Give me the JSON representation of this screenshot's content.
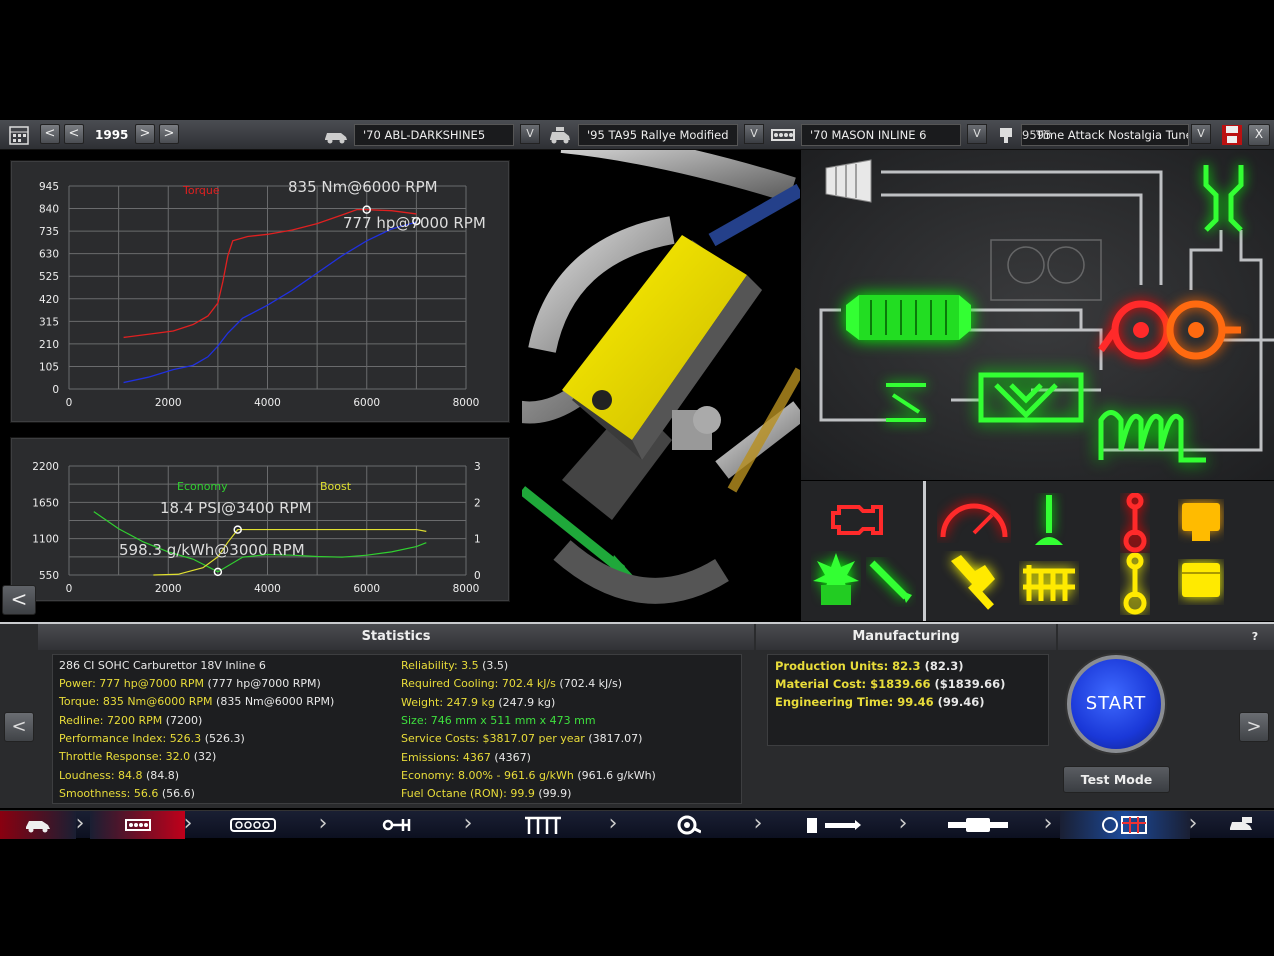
{
  "toolbar": {
    "year": "1995",
    "body_select": "'70   ABL-DARKSHINE5",
    "trim_select": "'95 TA95  Rallye Modified",
    "engine_select": "'70   MASON INLINE  6",
    "variant_select_prefix": "9595",
    "variant_select": "Time Attack  Nostalgia Tuned",
    "dropdown_glyph": "V",
    "prev_glyph": "<",
    "next_glyph": ">",
    "close_glyph": "X"
  },
  "power_chart": {
    "legend": "Torque",
    "annotation_torque": "835 Nm@6000 RPM",
    "annotation_power": "777 hp@7000 RPM"
  },
  "boost_chart": {
    "legend_economy": "Economy",
    "legend_boost": "Boost",
    "annotation_boost": "18.4 PSI@3400 RPM",
    "annotation_economy": "598.3 g/kWh@3000 RPM"
  },
  "chart_data": [
    {
      "type": "line",
      "title": "",
      "x_ticks": [
        "0",
        "2000",
        "4000",
        "6000",
        "8000"
      ],
      "y_ticks": [
        "0",
        "105",
        "210",
        "315",
        "420",
        "525",
        "630",
        "735",
        "840",
        "945"
      ],
      "xlim": [
        0,
        8000
      ],
      "ylim": [
        0,
        945
      ],
      "grid": true,
      "series": [
        {
          "name": "Torque",
          "color": "#e02020",
          "x": [
            1100,
            1600,
            2100,
            2500,
            2800,
            3000,
            3100,
            3200,
            3300,
            3600,
            4000,
            4500,
            5000,
            5500,
            5800,
            6000,
            6500,
            7000
          ],
          "y": [
            240,
            255,
            270,
            300,
            340,
            400,
            500,
            620,
            690,
            710,
            720,
            740,
            770,
            810,
            835,
            835,
            830,
            815
          ]
        },
        {
          "name": "",
          "color": "#2030e0",
          "x": [
            1100,
            1600,
            2100,
            2500,
            2800,
            3000,
            3200,
            3500,
            4000,
            4500,
            5000,
            5500,
            6000,
            6500,
            7000
          ],
          "y": [
            30,
            55,
            90,
            110,
            150,
            200,
            260,
            330,
            390,
            460,
            540,
            620,
            690,
            745,
            777
          ]
        }
      ]
    },
    {
      "type": "line",
      "title": "",
      "x_ticks": [
        "0",
        "2000",
        "4000",
        "6000",
        "8000"
      ],
      "y_left_ticks": [
        "550",
        "1100",
        "1650",
        "2200"
      ],
      "y_right_ticks": [
        "0",
        "1",
        "2",
        "3"
      ],
      "xlim": [
        0,
        8000
      ],
      "ylim_left": [
        550,
        2200
      ],
      "ylim_right": [
        0,
        3
      ],
      "grid": true,
      "series": [
        {
          "name": "Economy",
          "axis": "left",
          "color": "#30d030",
          "x": [
            500,
            1000,
            1500,
            2000,
            2500,
            3000,
            3500,
            4000,
            4500,
            5000,
            5500,
            6000,
            6500,
            7000,
            7200
          ],
          "y": [
            1510,
            1250,
            1050,
            900,
            790,
            598,
            820,
            860,
            850,
            830,
            820,
            850,
            900,
            980,
            1040
          ]
        },
        {
          "name": "Boost",
          "axis": "right",
          "color": "#e0e030",
          "x": [
            1700,
            2200,
            2700,
            3000,
            3200,
            3400,
            4000,
            5000,
            6000,
            7000,
            7200
          ],
          "y": [
            0,
            0.02,
            0.2,
            0.5,
            0.9,
            1.25,
            1.25,
            1.25,
            1.25,
            1.25,
            1.2
          ]
        }
      ]
    }
  ],
  "statistics": {
    "title": "Statistics",
    "description": "286 CI SOHC Carburettor 18V Inline 6",
    "left": [
      {
        "label": "Power: 777 hp@7000 RPM",
        "paren": "(777 hp@7000 RPM)",
        "color": "yellow"
      },
      {
        "label": "Torque: 835 Nm@6000 RPM",
        "paren": "(835 Nm@6000 RPM)",
        "color": "yellow"
      },
      {
        "label": "Redline: 7200 RPM",
        "paren": "(7200)",
        "color": "yellow"
      },
      {
        "label": "Performance Index: 526.3",
        "paren": "(526.3)",
        "color": "yellow"
      },
      {
        "label": "Throttle Response: 32.0",
        "paren": "(32)",
        "color": "yellow"
      },
      {
        "label": "Loudness: 84.8",
        "paren": "(84.8)",
        "color": "yellow"
      },
      {
        "label": "Smoothness: 56.6",
        "paren": "(56.6)",
        "color": "yellow"
      }
    ],
    "right": [
      {
        "label": "Reliability: 3.5",
        "paren": "(3.5)",
        "color": "yellow"
      },
      {
        "label": "Required Cooling: 702.4 kJ/s",
        "paren": "(702.4 kJ/s)",
        "color": "yellow"
      },
      {
        "label": "Weight: 247.9 kg",
        "paren": "(247.9 kg)",
        "color": "yellow"
      },
      {
        "label": "Size: 746 mm x 511 mm x 473 mm",
        "paren": "",
        "color": "green"
      },
      {
        "label": "Service Costs: $3817.07 per year",
        "paren": "(3817.07)",
        "color": "yellow"
      },
      {
        "label": "Emissions: 4367",
        "paren": "(4367)",
        "color": "yellow"
      },
      {
        "label": "Economy: 8.00% - 961.6 g/kWh",
        "paren": "(961.6 g/kWh)",
        "color": "yellow"
      },
      {
        "label": "Fuel Octane (RON): 99.9",
        "paren": "(99.9)",
        "color": "yellow"
      }
    ]
  },
  "manufacturing": {
    "title": "Manufacturing",
    "rows": [
      {
        "label": "Production Units: 82.3",
        "paren": "(82.3)"
      },
      {
        "label": "Material Cost: $1839.66",
        "paren": "($1839.66)"
      },
      {
        "label": "Engineering Time: 99.46",
        "paren": "(99.46)"
      }
    ],
    "start_label": "START",
    "test_mode_label": "Test Mode",
    "help_label": "?"
  },
  "colors": {
    "accent_yellow": "#e8dc3a",
    "accent_green": "#3ee03e",
    "torque_red": "#e02020",
    "power_blue": "#2030e0",
    "start_blue": "#1a38d8"
  },
  "bottom_nav": {
    "tabs": [
      "car-icon",
      "engine-block-icon",
      "head-icon",
      "crank-icon",
      "intake-icon",
      "turbo-icon",
      "fuel-icon",
      "exhaust-icon",
      "dyno-icon",
      "transfer-icon"
    ]
  }
}
